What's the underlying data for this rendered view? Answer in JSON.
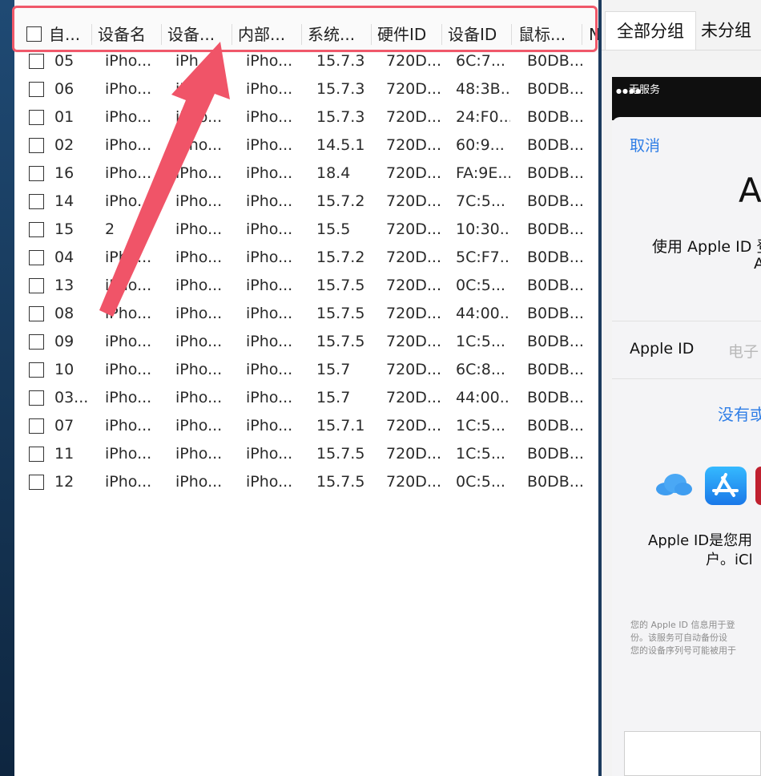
{
  "columns": [
    "自...",
    "设备名",
    "设备...",
    "内部...",
    "系统...",
    "硬件ID",
    "设备ID",
    "鼠标...",
    "N"
  ],
  "rows": [
    {
      "id": "05",
      "name": "iPho...",
      "model": "iPh...",
      "internal": "iPho...",
      "os": "15.7.3",
      "hw": "720D...",
      "device_id": "6C:7...",
      "mouse": "B0DB..."
    },
    {
      "id": "06",
      "name": "iPho...",
      "model": "iP...",
      "internal": "iPho...",
      "os": "15.7.3",
      "hw": "720D...",
      "device_id": "48:3B...",
      "mouse": "B0DB..."
    },
    {
      "id": "01",
      "name": "iPho...",
      "model": "iPho...",
      "internal": "iPho...",
      "os": "15.7.3",
      "hw": "720D...",
      "device_id": "24:F0...",
      "mouse": "B0DB..."
    },
    {
      "id": "02",
      "name": "iPho...",
      "model": "iPho...",
      "internal": "iPho...",
      "os": "14.5.1",
      "hw": "720D...",
      "device_id": "60:9...",
      "mouse": "B0DB..."
    },
    {
      "id": "16",
      "name": "iPho...",
      "model": "iPho...",
      "internal": "iPho...",
      "os": "18.4",
      "hw": "720D...",
      "device_id": "FA:9E...",
      "mouse": "B0DB..."
    },
    {
      "id": "14",
      "name": "iPho...",
      "model": "iPho...",
      "internal": "iPho...",
      "os": "15.7.2",
      "hw": "720D...",
      "device_id": "7C:5...",
      "mouse": "B0DB..."
    },
    {
      "id": "15",
      "name": "2",
      "model": "iPho...",
      "internal": "iPho...",
      "os": "15.5",
      "hw": "720D...",
      "device_id": "10:30...",
      "mouse": "B0DB..."
    },
    {
      "id": "04",
      "name": "iPho...",
      "model": "iPho...",
      "internal": "iPho...",
      "os": "15.7.2",
      "hw": "720D...",
      "device_id": "5C:F7...",
      "mouse": "B0DB..."
    },
    {
      "id": "13",
      "name": "iPho...",
      "model": "iPho...",
      "internal": "iPho...",
      "os": "15.7.5",
      "hw": "720D...",
      "device_id": "0C:5...",
      "mouse": "B0DB..."
    },
    {
      "id": "08",
      "name": "iPho...",
      "model": "iPho...",
      "internal": "iPho...",
      "os": "15.7.5",
      "hw": "720D...",
      "device_id": "44:00...",
      "mouse": "B0DB..."
    },
    {
      "id": "09",
      "name": "iPho...",
      "model": "iPho...",
      "internal": "iPho...",
      "os": "15.7.5",
      "hw": "720D...",
      "device_id": "1C:5...",
      "mouse": "B0DB..."
    },
    {
      "id": "10",
      "name": "iPho...",
      "model": "iPho...",
      "internal": "iPho...",
      "os": "15.7",
      "hw": "720D...",
      "device_id": "6C:8...",
      "mouse": "B0DB..."
    },
    {
      "id": "03...",
      "name": "iPho...",
      "model": "iPho...",
      "internal": "iPho...",
      "os": "15.7",
      "hw": "720D...",
      "device_id": "44:00...",
      "mouse": "B0DB..."
    },
    {
      "id": "07",
      "name": "iPho...",
      "model": "iPho...",
      "internal": "iPho...",
      "os": "15.7.1",
      "hw": "720D...",
      "device_id": "1C:5...",
      "mouse": "B0DB..."
    },
    {
      "id": "11",
      "name": "iPho...",
      "model": "iPho...",
      "internal": "iPho...",
      "os": "15.7.5",
      "hw": "720D...",
      "device_id": "1C:5...",
      "mouse": "B0DB..."
    },
    {
      "id": "12",
      "name": "iPho...",
      "model": "iPho...",
      "internal": "iPho...",
      "os": "15.7.5",
      "hw": "720D...",
      "device_id": "0C:5...",
      "mouse": "B0DB..."
    }
  ],
  "right_tabs": [
    "全部分组",
    "未分组"
  ],
  "phone": {
    "status": "无服务",
    "cancel": "取消",
    "title_partial": "A",
    "signin_partial": "使用 Apple ID 登",
    "signin_partial2": "A",
    "apple_id_label": "Apple ID",
    "apple_id_placeholder": "电子",
    "no_id_link": "没有或",
    "desc_line1": "Apple ID是您用",
    "desc_line2": "户。iCl",
    "fine_print": [
      "您的 Apple ID 信息用于登",
      "份。该服务可自动备份设",
      "您的设备序列号可能被用于"
    ]
  },
  "colors": {
    "highlight": "#f0586a",
    "arrow": "#f05468",
    "link": "#2f7ee6"
  }
}
